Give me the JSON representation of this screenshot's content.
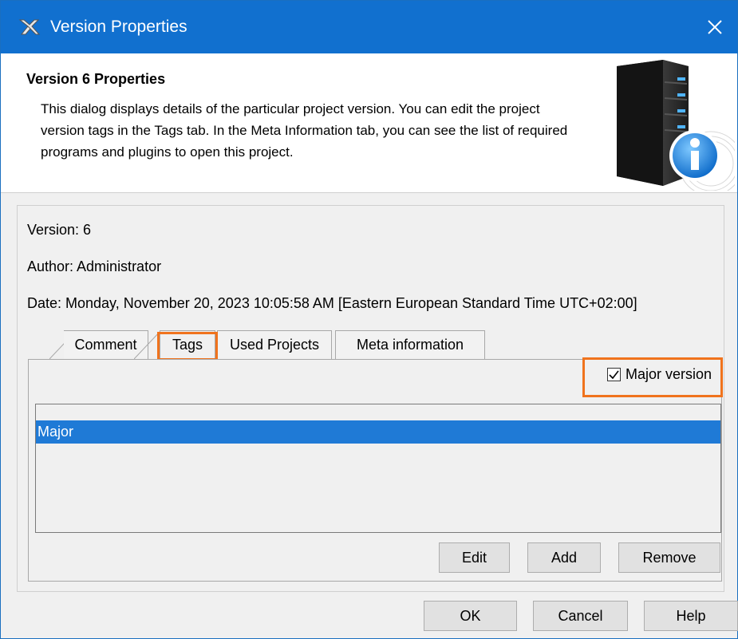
{
  "window": {
    "title": "Version Properties",
    "close_glyph": "✕"
  },
  "header": {
    "title": "Version 6 Properties",
    "description": "This dialog displays details of the particular project version. You can edit the project version tags in the Tags tab. In the Meta Information tab, you can see the list of required programs and plugins to open this project.",
    "icon": "server-info-icon"
  },
  "details": {
    "version": "Version: 6",
    "author": "Author: Administrator",
    "date": "Date: Monday, November 20, 2023 10:05:58 AM [Eastern European Standard Time UTC+02:00]"
  },
  "tabs": [
    {
      "label": "Comment"
    },
    {
      "label": "Tags",
      "selected": true
    },
    {
      "label": "Used Projects"
    },
    {
      "label": "Meta information"
    }
  ],
  "tags_panel": {
    "major_version_label": "Major version",
    "major_version_checked": true,
    "tags": [
      "Major"
    ],
    "edit_label": "Edit",
    "add_label": "Add",
    "remove_label": "Remove"
  },
  "footer": {
    "ok_label": "OK",
    "cancel_label": "Cancel",
    "help_label": "Help"
  },
  "colors": {
    "titlebar": "#1170cf",
    "selection": "#1f7ad6",
    "highlight": "#f0731d"
  }
}
